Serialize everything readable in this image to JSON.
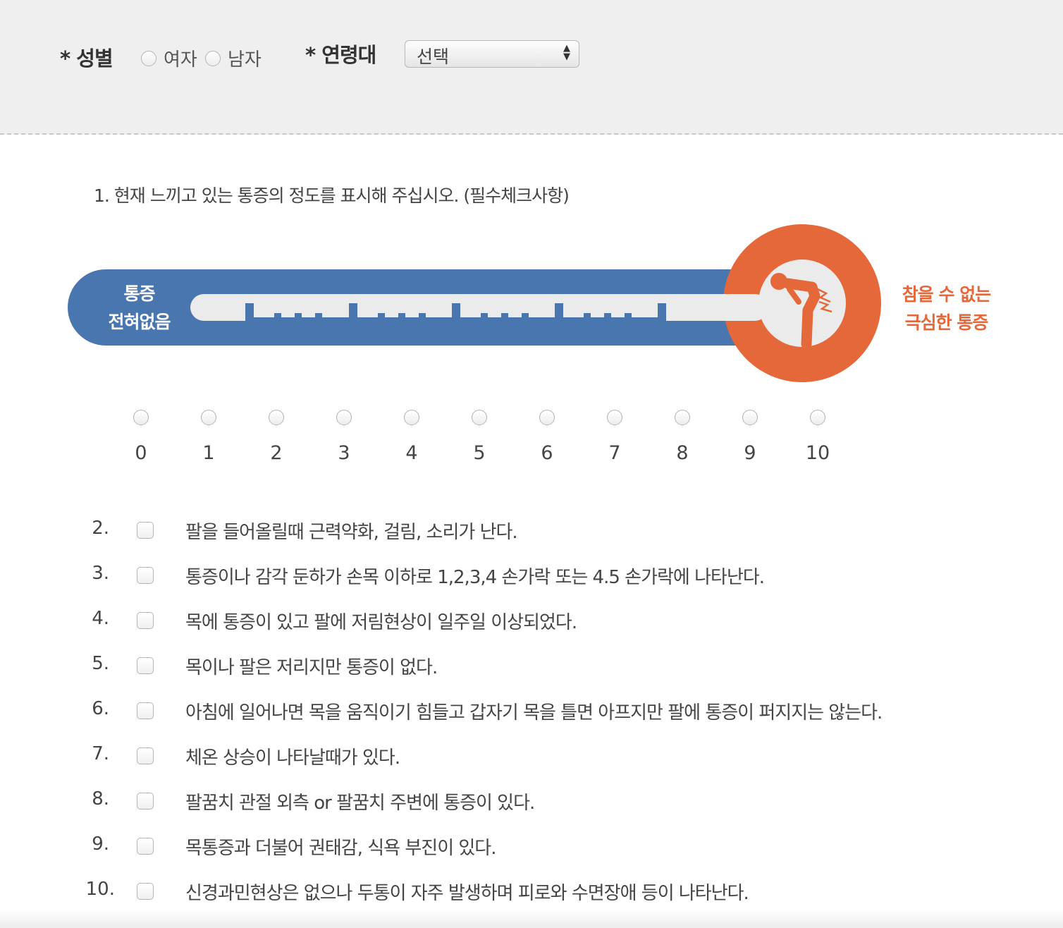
{
  "header": {
    "gender_label": "* 성별",
    "gender_options": [
      "여자",
      "남자"
    ],
    "age_label": "* 연령대",
    "age_select_value": "선택"
  },
  "question1": {
    "text": "1. 현재 느끼고 있는 통증의 정도를 표시해 주십시오. (필수체크사항)",
    "scale_left_line1": "통증",
    "scale_left_line2": "전혀없음",
    "scale_right_line1": "참을 수 없는",
    "scale_right_line2": "극심한 통증",
    "options": [
      "0",
      "1",
      "2",
      "3",
      "4",
      "5",
      "6",
      "7",
      "8",
      "9",
      "10"
    ]
  },
  "items": [
    {
      "num": "2.",
      "text": "팔을 들어올릴때 근력약화, 걸림, 소리가 난다."
    },
    {
      "num": "3.",
      "text": "통증이나 감각 둔하가 손목 이하로 1,2,3,4 손가락 또는 4.5 손가락에 나타난다."
    },
    {
      "num": "4.",
      "text": "목에 통증이 있고 팔에 저림현상이 일주일 이상되었다."
    },
    {
      "num": "5.",
      "text": "목이나 팔은 저리지만 통증이 없다."
    },
    {
      "num": "6.",
      "text": "아침에 일어나면 목을 움직이기 힘들고 갑자기 목을 틀면 아프지만 팔에 통증이 퍼지지는 않는다."
    },
    {
      "num": "7.",
      "text": "체온 상승이 나타날때가 있다."
    },
    {
      "num": "8.",
      "text": "팔꿈치 관절 외측 or 팔꿈치 주변에 통증이 있다."
    },
    {
      "num": "9.",
      "text": "목통증과 더불어 권태감, 식욕 부진이 있다."
    },
    {
      "num": "10.",
      "text": "신경과민현상은 없으나 두통이 자주 발생하며 피로와 수면장애 등이 나타난다."
    }
  ],
  "colors": {
    "blue": "#4a76b0",
    "orange": "#e5683a",
    "track": "#ebebeb"
  },
  "icons": {
    "pain_figure": "person-back-pain-icon"
  }
}
